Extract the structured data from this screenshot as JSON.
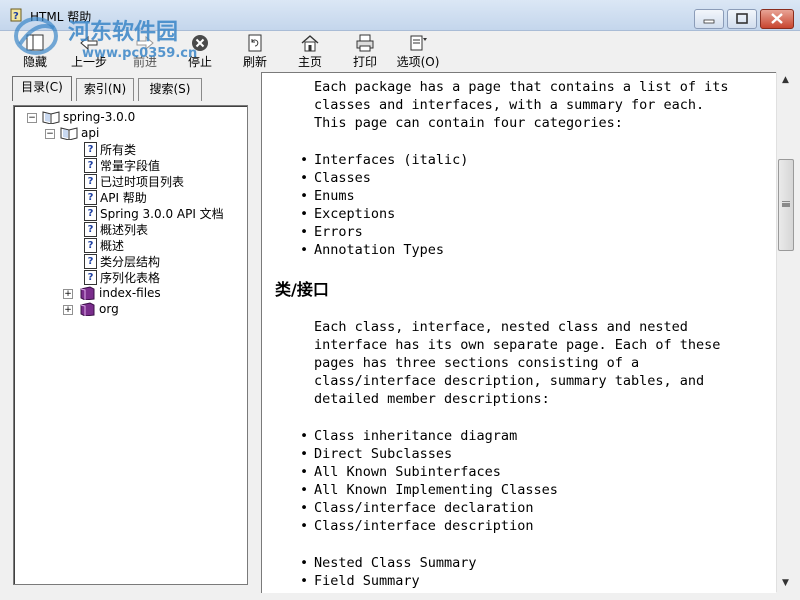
{
  "window": {
    "title": "HTML 帮助",
    "icon": "help-book-icon"
  },
  "watermark": {
    "site_name": "河东软件园",
    "url": "www.pc0359.cn"
  },
  "toolbar": {
    "hide": "隐藏",
    "back": "上一步",
    "forward": "前进",
    "stop": "停止",
    "refresh": "刷新",
    "home": "主页",
    "print": "打印",
    "options": "选项(O)"
  },
  "tabs": {
    "contents": "目录(C)",
    "index": "索引(N)",
    "search": "搜索(S)"
  },
  "tree": {
    "root": "spring-3.0.0",
    "api": "api",
    "api_children": [
      "所有类",
      "常量字段值",
      "已过时项目列表",
      "API 帮助",
      "Spring 3.0.0 API 文档",
      "概述列表",
      "概述",
      "类分层结构",
      "序列化表格"
    ],
    "index_files": "index-files",
    "org": "org"
  },
  "content": {
    "intro_lines": [
      "Each package has a page that contains a list of its",
      "classes and interfaces, with a summary for each.",
      "This page can contain four categories:"
    ],
    "categories": [
      "Interfaces (italic)",
      "Classes",
      "Enums",
      "Exceptions",
      "Errors",
      "Annotation Types"
    ],
    "heading": "类/接口",
    "class_lines": [
      "Each class, interface, nested class and nested",
      "interface has its own separate page. Each of these",
      "pages has three sections consisting of a",
      "class/interface description, summary tables, and",
      "detailed member descriptions:"
    ],
    "sections_a": [
      "Class inheritance diagram",
      "Direct Subclasses",
      "All Known Subinterfaces",
      "All Known Implementing Classes",
      "Class/interface declaration",
      "Class/interface description"
    ],
    "sections_b": [
      "Nested Class Summary",
      "Field Summary"
    ]
  }
}
